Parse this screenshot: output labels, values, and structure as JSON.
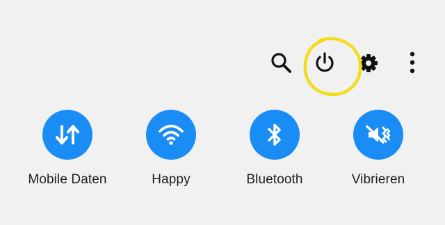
{
  "toolbar": {
    "search_icon": "search-icon",
    "power_icon": "power-icon",
    "settings_icon": "gear-icon",
    "more_icon": "more-vertical-icon",
    "highlight_color": "#f3dc1b"
  },
  "tiles": [
    {
      "label": "Mobile Daten",
      "icon": "mobile-data-icon",
      "active": true
    },
    {
      "label": "Happy",
      "icon": "wifi-icon",
      "active": true
    },
    {
      "label": "Bluetooth",
      "icon": "bluetooth-icon",
      "active": true
    },
    {
      "label": "Vibrieren",
      "icon": "vibrate-icon",
      "active": true
    }
  ],
  "colors": {
    "background": "#f1f1f1",
    "tile_active": "#1a8cf5",
    "icon_foreground": "#111111",
    "tile_icon": "#ffffff"
  }
}
